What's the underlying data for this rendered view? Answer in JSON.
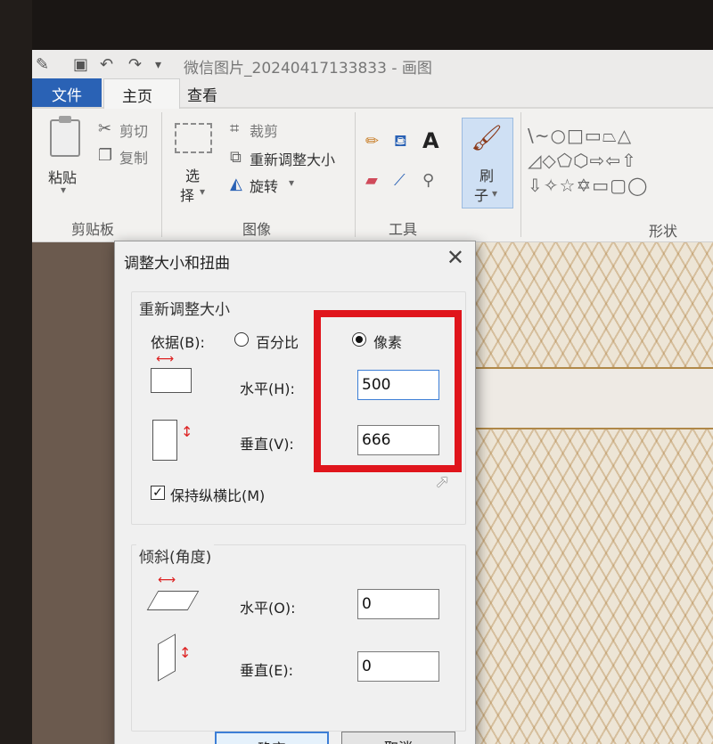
{
  "window": {
    "title": "微信图片_20240417133833 - 画图"
  },
  "quick_access": {
    "icons": [
      "paint-app-icon",
      "save-icon",
      "undo-icon",
      "redo-icon",
      "customize-dropdown-icon"
    ]
  },
  "ribbon": {
    "tabs": {
      "file": "文件",
      "home": "主页",
      "view": "查看"
    },
    "clipboard": {
      "paste": "粘贴",
      "cut": "剪切",
      "copy": "复制",
      "label": "剪贴板"
    },
    "image": {
      "select_1": "选",
      "select_2": "择",
      "crop": "裁剪",
      "resize": "重新调整大小",
      "rotate": "旋转",
      "label": "图像"
    },
    "tools": {
      "label": "工具"
    },
    "brushes": {
      "label_1": "刷",
      "label_2": "子"
    },
    "shapes": {
      "label": "形状",
      "glyphs": "\\∼○□▭⏢△\n◿◇⬠⬡⇨⇦⇧\n⇩✧☆✡▭▢◯"
    }
  },
  "dialog": {
    "title": "调整大小和扭曲",
    "close": "✕",
    "resize": {
      "title": "重新调整大小",
      "by_label": "依据(B):",
      "percentage": "百分比",
      "pixels": "像素",
      "selected": "pixels",
      "horizontal_label": "水平(H):",
      "horizontal_value": "500",
      "vertical_label": "垂直(V):",
      "vertical_value": "666",
      "maintain_aspect": "保持纵横比(M)",
      "maintain_aspect_checked": true
    },
    "skew": {
      "title": "倾斜(角度)",
      "horizontal_label": "水平(O):",
      "horizontal_value": "0",
      "vertical_label": "垂直(E):",
      "vertical_value": "0"
    },
    "buttons": {
      "ok": "确定",
      "cancel": "取消"
    }
  },
  "colors": {
    "file_tab": "#2a62b5",
    "highlight": "#e0151c",
    "focus_border": "#3c7ed6"
  }
}
